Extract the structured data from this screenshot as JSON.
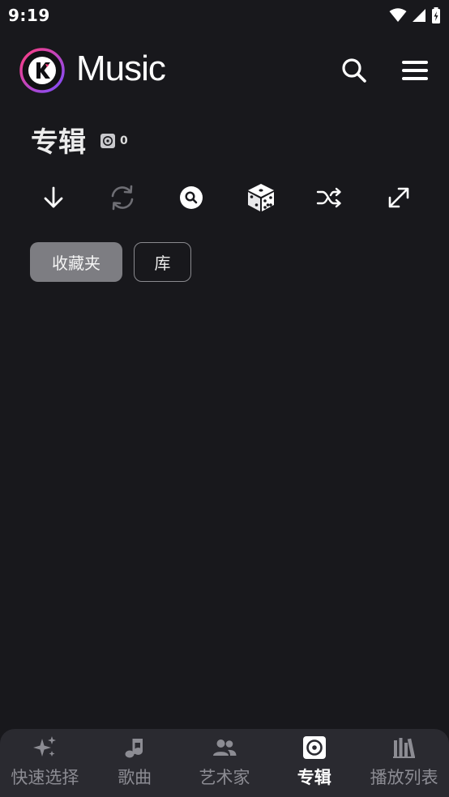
{
  "status": {
    "time": "9:19"
  },
  "header": {
    "title": "Music"
  },
  "section": {
    "title": "专辑",
    "count": "0"
  },
  "chips": [
    {
      "label": "收藏夹",
      "selected": true
    },
    {
      "label": "库",
      "selected": false
    }
  ],
  "nav": [
    {
      "label": "快速选择",
      "icon": "sparkles-icon",
      "active": false
    },
    {
      "label": "歌曲",
      "icon": "music-note-icon",
      "active": false
    },
    {
      "label": "艺术家",
      "icon": "people-icon",
      "active": false
    },
    {
      "label": "专辑",
      "icon": "album-icon",
      "active": true
    },
    {
      "label": "播放列表",
      "icon": "library-icon",
      "active": false
    }
  ],
  "colors": {
    "background": "#18181c",
    "nav_background": "#2a2a30",
    "chip_selected": "#7d7d82",
    "logo_ring_1": "#ff3d7f",
    "logo_ring_2": "#7c4dff"
  }
}
